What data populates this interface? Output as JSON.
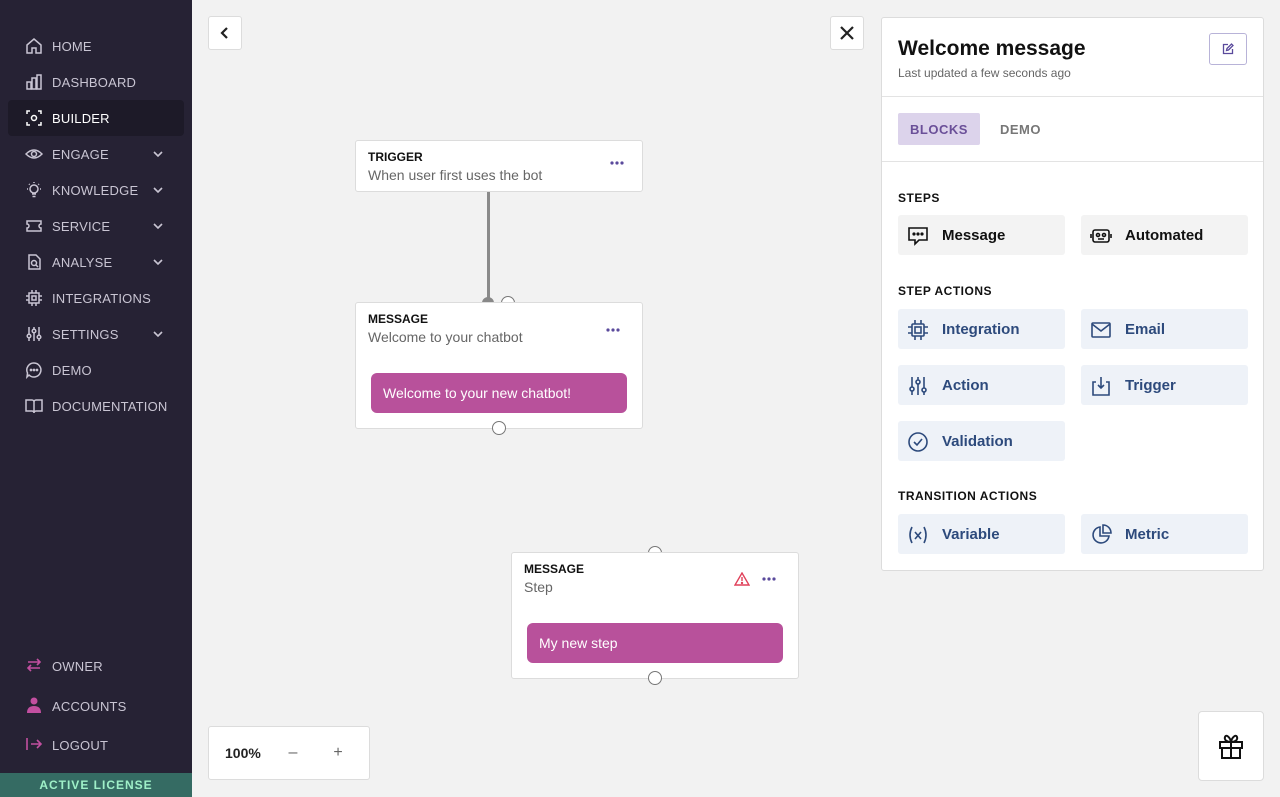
{
  "sidebar": {
    "items": [
      {
        "label": "HOME",
        "icon": "home-icon",
        "active": false,
        "expandable": false
      },
      {
        "label": "DASHBOARD",
        "icon": "bar-chart-icon",
        "active": false,
        "expandable": false
      },
      {
        "label": "BUILDER",
        "icon": "builder-icon",
        "active": true,
        "expandable": false
      },
      {
        "label": "ENGAGE",
        "icon": "eye-icon",
        "active": false,
        "expandable": true
      },
      {
        "label": "KNOWLEDGE",
        "icon": "lightbulb-icon",
        "active": false,
        "expandable": true
      },
      {
        "label": "SERVICE",
        "icon": "ticket-icon",
        "active": false,
        "expandable": true
      },
      {
        "label": "ANALYSE",
        "icon": "analyse-icon",
        "active": false,
        "expandable": true
      },
      {
        "label": "INTEGRATIONS",
        "icon": "chip-icon",
        "active": false,
        "expandable": false
      },
      {
        "label": "SETTINGS",
        "icon": "sliders-icon",
        "active": false,
        "expandable": true
      },
      {
        "label": "DEMO",
        "icon": "chat-bubble-icon",
        "active": false,
        "expandable": false
      },
      {
        "label": "DOCUMENTATION",
        "icon": "book-icon",
        "active": false,
        "expandable": false
      }
    ],
    "bottom": [
      {
        "label": "OWNER",
        "icon": "swap-icon"
      },
      {
        "label": "ACCOUNTS",
        "icon": "user-icon"
      },
      {
        "label": "LOGOUT",
        "icon": "logout-icon"
      }
    ],
    "license": "ACTIVE LICENSE"
  },
  "canvas": {
    "zoom": "100%",
    "zoom_out": "–",
    "zoom_in": "+",
    "nodes": {
      "trigger": {
        "type": "TRIGGER",
        "subtitle": "When user first uses the bot"
      },
      "message1": {
        "type": "MESSAGE",
        "subtitle": "Welcome to your chatbot",
        "bubble": "Welcome to your new chatbot!"
      },
      "message2": {
        "type": "MESSAGE",
        "subtitle": "Step",
        "bubble": "My new step"
      }
    }
  },
  "panel": {
    "title": "Welcome message",
    "updated": "Last updated a few seconds ago",
    "tabs": [
      "BLOCKS",
      "DEMO"
    ],
    "sections": {
      "steps": {
        "label": "STEPS",
        "blocks": [
          "Message",
          "Automated"
        ]
      },
      "step_actions": {
        "label": "STEP ACTIONS",
        "blocks": [
          "Integration",
          "Email",
          "Action",
          "Trigger",
          "Validation"
        ]
      },
      "transition_actions": {
        "label": "TRANSITION ACTIONS",
        "blocks": [
          "Variable",
          "Metric"
        ]
      }
    }
  },
  "colors": {
    "sidebar_bg": "#262234",
    "accent_pink": "#b8519b",
    "tab_active_bg": "#dcd3eb",
    "action_text": "#2d4a7c",
    "license_bg": "#356b63",
    "warning": "#e0405a"
  }
}
